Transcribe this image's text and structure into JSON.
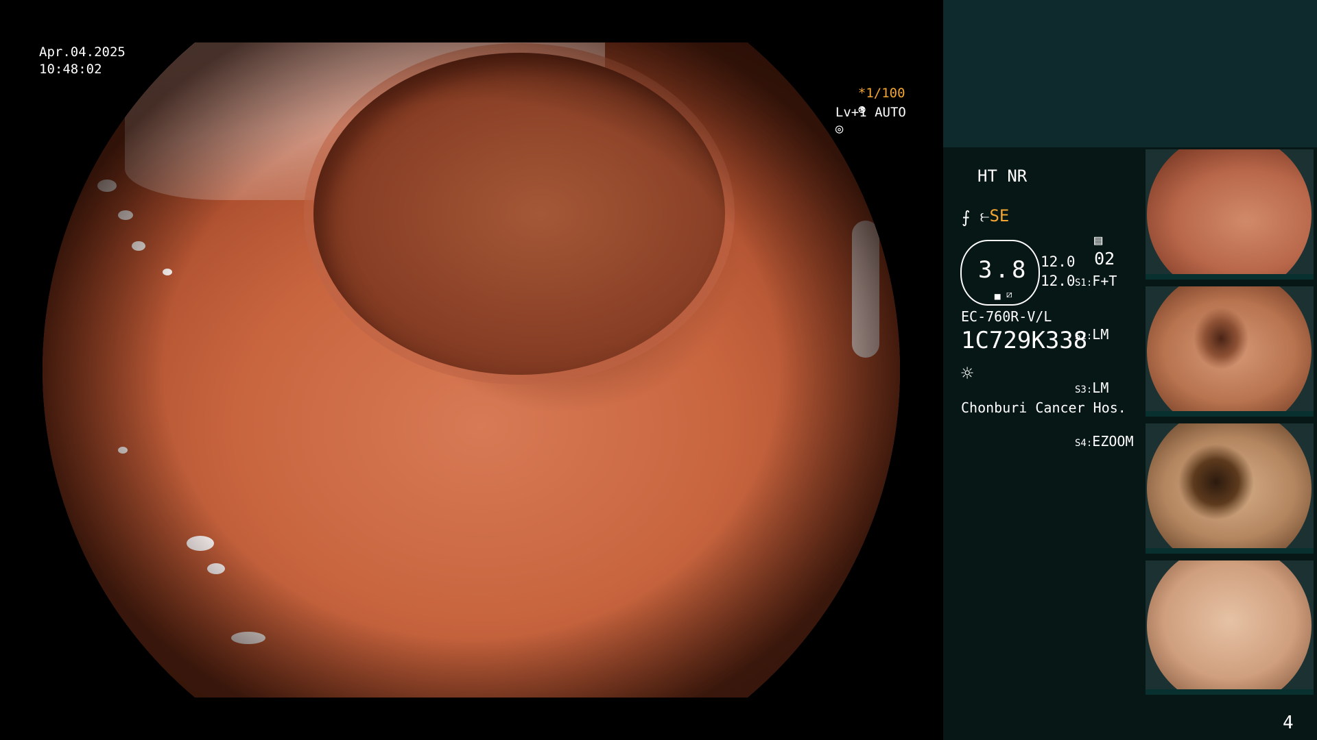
{
  "overlay": {
    "date": "Apr.04.2025",
    "time": "10:48:02",
    "shutter": "*1/100",
    "shutter_icon": "aperture-icon",
    "level": "Lv+1 AUTO",
    "level_icon": "auto-iris-icon"
  },
  "panel": {
    "ht_nr": "HT NR",
    "se": "SE",
    "se_icon": "structure-enhance-icon",
    "color_icon": "color-mode-icon",
    "memory_value": "02",
    "memory_icon": "memory-icon",
    "zoom": "3.8",
    "level_a": "12.0",
    "level_b": "12.0",
    "switches": [
      {
        "key": "S1:",
        "value": "F+T"
      },
      {
        "key": "S2:",
        "value": "LM"
      },
      {
        "key": "S3:",
        "value": "LM"
      },
      {
        "key": "S4:",
        "value": "EZOOM"
      }
    ],
    "scope_model": "EC-760R-V/L",
    "scope_serial": "1C729K338",
    "light_icon": "light-source-icon",
    "hospital": "Chonburi Cancer Hos."
  },
  "thumbnails": [
    {
      "label": "thumbnail-1"
    },
    {
      "label": "thumbnail-2"
    },
    {
      "label": "thumbnail-3"
    },
    {
      "label": "thumbnail-4"
    }
  ],
  "page_number": "4",
  "colors": {
    "background": "#000000",
    "panel": "#071716",
    "panel_top": "#0f2a2c",
    "accent_orange": "#f2a531"
  }
}
